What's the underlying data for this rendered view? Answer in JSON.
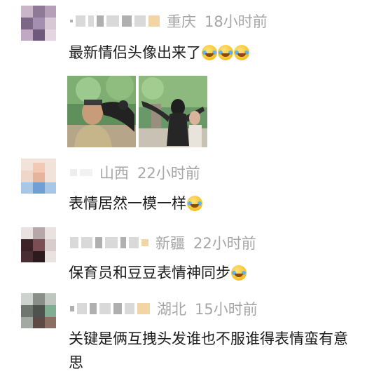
{
  "comments": [
    {
      "location": "重庆",
      "time": "18小时前",
      "text": "最新情侣头像出来了",
      "emojis": [
        "laugh-cry-icon",
        "laugh-cry-icon",
        "laugh-cry-icon"
      ]
    },
    {
      "location": "山西",
      "time": "22小时前",
      "text": "表情居然一模一样",
      "emojis": [
        "laugh-cry-icon"
      ]
    },
    {
      "location": "新疆",
      "time": "22小时前",
      "text": "保育员和豆豆表情神同步",
      "emojis": [
        "laugh-cry-icon"
      ]
    },
    {
      "location": "湖北",
      "time": "15小时前",
      "text": "关键是俩互拽头发谁也不服谁得表情蛮有意思",
      "emojis": []
    }
  ],
  "colors": {
    "meta_text": "#a6a6a6",
    "body_text": "#1a1a1a",
    "emoji": "#f7c531"
  }
}
